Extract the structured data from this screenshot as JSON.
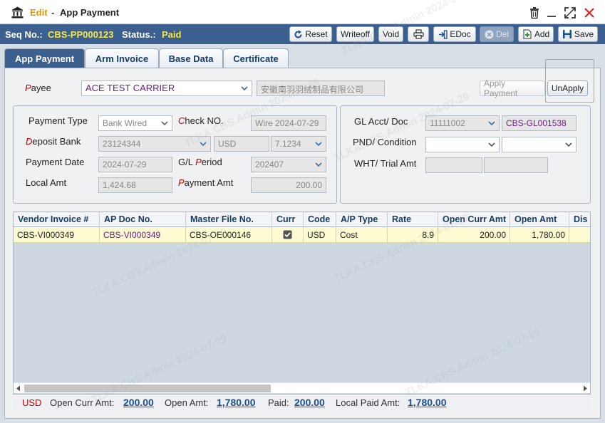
{
  "window": {
    "mode": "Edit",
    "separator": "-",
    "title": "App Payment"
  },
  "toolbar": {
    "seq_label": "Seq No.:",
    "seq_value": "CBS-PP000123",
    "status_label": "Status.:",
    "status_value": "Paid",
    "buttons": {
      "reset": "Reset",
      "writeoff": "Writeoff",
      "void": "Void",
      "edoc": "EDoc",
      "del": "Del",
      "add": "Add",
      "save": "Save"
    }
  },
  "tabs": [
    "App Payment",
    "Arm Invoice",
    "Base Data",
    "Certificate"
  ],
  "payee": {
    "label_first": "P",
    "label_rest": "ayee",
    "value": "ACE TEST CARRIER",
    "chinese_name": "安徽南羽羽绒制品有限公司",
    "apply_payment": "Apply Payment",
    "unapply": "UnApply"
  },
  "form": {
    "payment_type_label": "Payment Type",
    "payment_type_value": "Bank Wired",
    "check_no_label_first": "C",
    "check_no_label_rest": "heck NO.",
    "check_no_value": "Wire 2024-07-29",
    "deposit_bank_label_first": "D",
    "deposit_bank_label_rest": "eposit Bank",
    "deposit_bank_value": "23124344",
    "currency_value": "USD",
    "rate_value": "7.1234",
    "payment_date_label": "Payment Date",
    "payment_date_value": "2024-07-29",
    "gl_period_label_a": "G/L ",
    "gl_period_label_r": "P",
    "gl_period_label_b": "eriod",
    "gl_period_value": "202407",
    "local_amt_label": "Local Amt",
    "local_amt_value": "1,424.68",
    "payment_amt_label_first": "P",
    "payment_amt_label_rest": "ayment Amt",
    "payment_amt_value": "200.00"
  },
  "gl": {
    "gl_acct_label": "GL Acct/ Doc",
    "gl_acct_value": "11111002",
    "gl_doc_value": "CBS-GL001538",
    "pnd_label": "PND/  Condition",
    "pnd_value": "",
    "condition_value": "",
    "wht_label": "WHT/ Trial Amt",
    "wht_value": "",
    "trial_value": ""
  },
  "grid": {
    "columns": [
      "Vendor Invoice #",
      "AP Doc No.",
      "Master File No.",
      "Curr",
      "Code",
      "A/P Type",
      "Rate",
      "Open Curr Amt",
      "Open Amt",
      "Dis"
    ],
    "rows": [
      {
        "vendor_invoice": "CBS-VI000349",
        "ap_doc": "CBS-VI000349",
        "master_file": "CBS-OE000146",
        "curr_checked": true,
        "code": "USD",
        "ap_type": "Cost",
        "rate": "8.9",
        "open_curr_amt": "200.00",
        "open_amt": "1,780.00",
        "dis": ""
      }
    ]
  },
  "footer": {
    "currency": "USD",
    "open_curr_label": "Open Curr Amt:",
    "open_curr_value": "200.00",
    "open_amt_label": "Open Amt:",
    "open_amt_value": "1,780.00",
    "paid_label": "Paid:",
    "paid_value": "200.00",
    "local_paid_label": "Local Paid Amt:",
    "local_paid_value": "1,780.00"
  },
  "watermark": "TLKA.CBS.Admin 2024-07-29",
  "colors": {
    "header_blue": "#3b5f8e",
    "accent_yellow": "#f5e64a",
    "edit_orange": "#e39a00",
    "link_blue": "#1c4f8c",
    "row_yellow": "#fdfbd1"
  }
}
